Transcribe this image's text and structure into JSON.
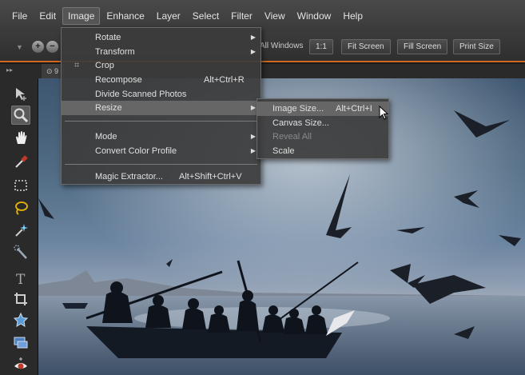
{
  "menubar": {
    "items": [
      "File",
      "Edit",
      "Image",
      "Enhance",
      "Layer",
      "Select",
      "Filter",
      "View",
      "Window",
      "Help"
    ],
    "active_index": 2
  },
  "optionsbar": {
    "zoom_out_icon": "zoom-out-icon",
    "zoom_in_icon": "zoom-in-icon",
    "all_windows_label": "All Windows",
    "buttons": [
      "1:1",
      "Fit Screen",
      "Fill Screen",
      "Print Size"
    ],
    "accent_color": "#d2691e"
  },
  "document": {
    "tab_label": "9"
  },
  "toolbox": {
    "tools": [
      "move-tool-icon",
      "zoom-tool-icon",
      "hand-tool-icon",
      "eyedropper-tool-icon",
      "marquee-tool-icon",
      "lasso-tool-icon",
      "magic-wand-tool-icon",
      "quick-selection-tool-icon",
      "type-tool-icon",
      "crop-tool-icon",
      "shape-tool-icon",
      "recompose-tool-icon",
      "red-eye-tool-icon"
    ],
    "selected": "zoom-tool-icon"
  },
  "image_menu": {
    "items": [
      {
        "label": "Rotate",
        "submenu": true
      },
      {
        "label": "Transform",
        "submenu": true
      },
      {
        "label": "Crop",
        "icon": "crop-icon"
      },
      {
        "label": "Recompose",
        "shortcut": "Alt+Ctrl+R"
      },
      {
        "label": "Divide Scanned Photos"
      },
      {
        "label": "Resize",
        "submenu": true,
        "highlighted": true
      },
      {
        "label": "Mode",
        "submenu": true
      },
      {
        "label": "Convert Color Profile",
        "submenu": true
      },
      {
        "label": "Magic Extractor...",
        "shortcut": "Alt+Shift+Ctrl+V"
      }
    ]
  },
  "resize_submenu": {
    "items": [
      {
        "label": "Image Size...",
        "shortcut": "Alt+Ctrl+I",
        "highlighted": true
      },
      {
        "label": "Canvas Size..."
      },
      {
        "label": "Reveal All",
        "disabled": true
      },
      {
        "label": "Scale"
      }
    ]
  }
}
